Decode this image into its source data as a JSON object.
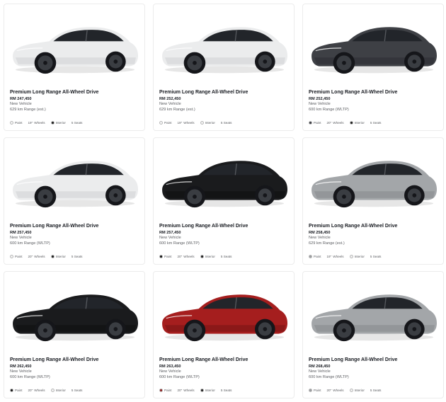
{
  "listings": [
    {
      "title": "Premium Long Range All-Wheel Drive",
      "price": "RM 247,450",
      "condition": "New Vehicle",
      "range": "629 km Range (est.)",
      "paint_label": "Paint",
      "paint_color": "#f4f4f4",
      "wheels_size": "19\"",
      "wheels_label": "Wheels",
      "interior_label": "Interior",
      "interior_color": "#1c1c1c",
      "seats": "5 Seats",
      "body_color": "#ebeced",
      "body_shade": "#bfc2c5"
    },
    {
      "title": "Premium Long Range All-Wheel Drive",
      "price": "RM 252,450",
      "condition": "New Vehicle",
      "range": "629 km Range (est.)",
      "paint_label": "Paint",
      "paint_color": "#f4f4f4",
      "wheels_size": "19\"",
      "wheels_label": "Wheels",
      "interior_label": "Interior",
      "interior_color": "#f2f2f2",
      "seats": "5 Seats",
      "body_color": "#ebeced",
      "body_shade": "#bfc2c5"
    },
    {
      "title": "Premium Long Range All-Wheel Drive",
      "price": "RM 252,450",
      "condition": "New Vehicle",
      "range": "600 km Range (WLTP)",
      "paint_label": "Paint",
      "paint_color": "#3b3d42",
      "wheels_size": "20\"",
      "wheels_label": "Wheels",
      "interior_label": "Interior",
      "interior_color": "#1c1c1c",
      "seats": "5 Seats",
      "body_color": "#3e4045",
      "body_shade": "#222327"
    },
    {
      "title": "Premium Long Range All-Wheel Drive",
      "price": "RM 257,450",
      "condition": "New Vehicle",
      "range": "600 km Range (WLTP)",
      "paint_label": "Paint",
      "paint_color": "#f4f4f4",
      "wheels_size": "20\"",
      "wheels_label": "Wheels",
      "interior_label": "Interior",
      "interior_color": "#1c1c1c",
      "seats": "5 Seats",
      "body_color": "#ebeced",
      "body_shade": "#bfc2c5"
    },
    {
      "title": "Premium Long Range All-Wheel Drive",
      "price": "RM 257,450",
      "condition": "New Vehicle",
      "range": "600 km Range (WLTP)",
      "paint_label": "Paint",
      "paint_color": "#111111",
      "wheels_size": "20\"",
      "wheels_label": "Wheels",
      "interior_label": "Interior",
      "interior_color": "#1c1c1c",
      "seats": "5 Seats",
      "body_color": "#1a1b1d",
      "body_shade": "#08090a"
    },
    {
      "title": "Premium Long Range All-Wheel Drive",
      "price": "RM 258,450",
      "condition": "New Vehicle",
      "range": "629 km Range (est.)",
      "paint_label": "Paint",
      "paint_color": "#9a9c9f",
      "wheels_size": "19\"",
      "wheels_label": "Wheels",
      "interior_label": "Interior",
      "interior_color": "#f2f2f2",
      "seats": "5 Seats",
      "body_color": "#a3a6a9",
      "body_shade": "#75787b"
    },
    {
      "title": "Premium Long Range All-Wheel Drive",
      "price": "RM 262,450",
      "condition": "New Vehicle",
      "range": "600 km Range (WLTP)",
      "paint_label": "Paint",
      "paint_color": "#111111",
      "wheels_size": "20\"",
      "wheels_label": "Wheels",
      "interior_label": "Interior",
      "interior_color": "#f2f2f2",
      "seats": "5 Seats",
      "body_color": "#1a1b1d",
      "body_shade": "#08090a"
    },
    {
      "title": "Premium Long Range All-Wheel Drive",
      "price": "RM 263,450",
      "condition": "New Vehicle",
      "range": "600 km Range (WLTP)",
      "paint_label": "Paint",
      "paint_color": "#8e1c1c",
      "wheels_size": "20\"",
      "wheels_label": "Wheels",
      "interior_label": "Interior",
      "interior_color": "#1c1c1c",
      "seats": "5 Seats",
      "body_color": "#a51e1e",
      "body_shade": "#5c0d0d"
    },
    {
      "title": "Premium Long Range All-Wheel Drive",
      "price": "RM 268,450",
      "condition": "New Vehicle",
      "range": "600 km Range (WLTP)",
      "paint_label": "Paint",
      "paint_color": "#9a9c9f",
      "wheels_size": "20\"",
      "wheels_label": "Wheels",
      "interior_label": "Interior",
      "interior_color": "#f2f2f2",
      "seats": "5 Seats",
      "body_color": "#a3a6a9",
      "body_shade": "#75787b"
    }
  ]
}
